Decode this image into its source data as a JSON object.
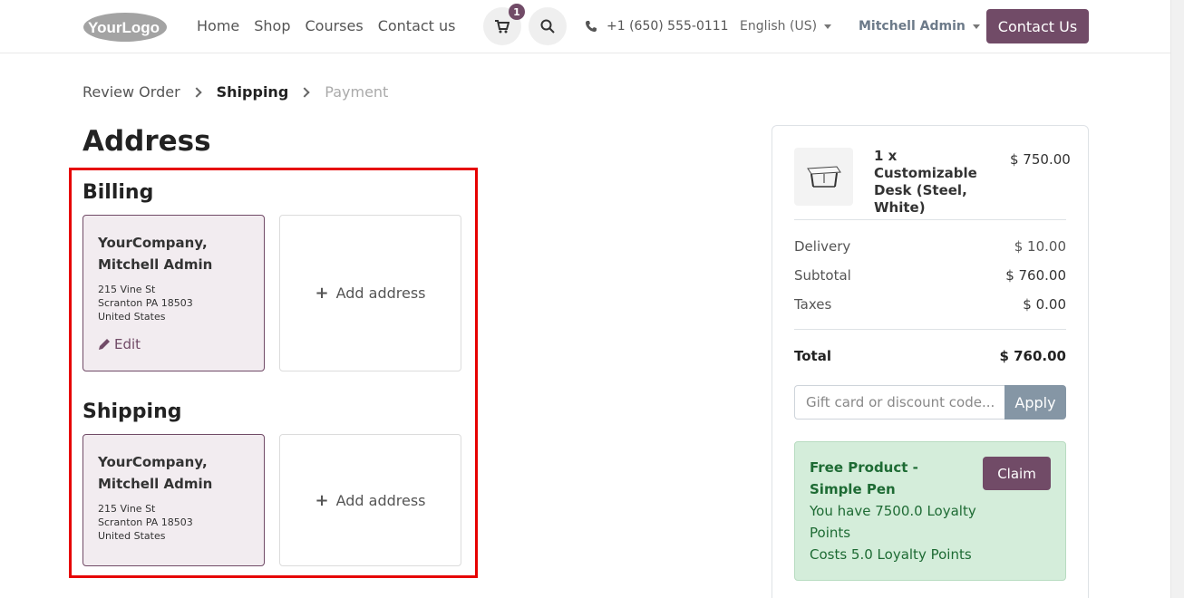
{
  "header": {
    "logo_text": "YourLogo",
    "nav": [
      "Home",
      "Shop",
      "Courses",
      "Contact us"
    ],
    "cart_count": "1",
    "phone": "+1 (650) 555-0111",
    "language": "English (US)",
    "user": "Mitchell Admin",
    "contact_button": "Contact Us"
  },
  "breadcrumb": {
    "step1": "Review Order",
    "step2": "Shipping",
    "step3": "Payment"
  },
  "page_title": "Address",
  "billing": {
    "title": "Billing",
    "name": "YourCompany, Mitchell Admin",
    "street": "215 Vine St",
    "city": "Scranton PA 18503",
    "country": "United States",
    "edit": "Edit",
    "add": "Add address"
  },
  "shipping": {
    "title": "Shipping",
    "name": "YourCompany, Mitchell Admin",
    "street": "215 Vine St",
    "city": "Scranton PA 18503",
    "country": "United States",
    "add": "Add address"
  },
  "summary": {
    "product_name": "1 x Customizable Desk (Steel, White)",
    "product_price": "$ 750.00",
    "delivery_label": "Delivery",
    "delivery_value": "$ 10.00",
    "subtotal_label": "Subtotal",
    "subtotal_value": "$ 760.00",
    "taxes_label": "Taxes",
    "taxes_value": "$ 0.00",
    "total_label": "Total",
    "total_value": "$ 760.00",
    "coupon_placeholder": "Gift card or discount code...",
    "apply": "Apply",
    "reward_title": "Free Product - Simple Pen",
    "reward_line1": "You have 7500.0 Loyalty Points",
    "reward_line2": "Costs 5.0 Loyalty Points",
    "claim": "Claim"
  },
  "colors": {
    "primary": "#714b67",
    "highlight": "#e60000",
    "reward_bg": "#d4edda",
    "reward_text": "#1e6b34"
  }
}
